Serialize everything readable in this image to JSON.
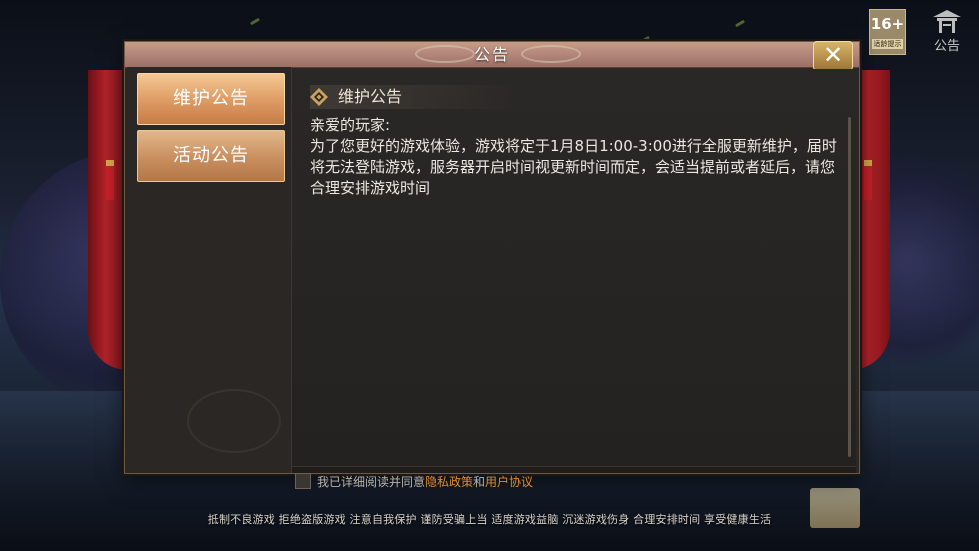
{
  "window": {
    "title": "公告",
    "close_label": "✕"
  },
  "top_right": {
    "age_rating": "16+",
    "age_tip": "适龄提示",
    "notice_label": "公告"
  },
  "sidebar": {
    "tabs": [
      {
        "label": "维护公告",
        "active": true
      },
      {
        "label": "活动公告",
        "active": false
      }
    ]
  },
  "content": {
    "heading": "维护公告",
    "greeting": "亲爱的玩家:",
    "body": "为了您更好的游戏体验，游戏将定于1月8日1:00-3:00进行全服更新维护，届时将无法登陆游戏，服务器开启时间视更新时间而定，会适当提前或者延后，请您合理安排游戏时间"
  },
  "agreement": {
    "prefix": "我已详细阅读并同意",
    "privacy_link": "隐私政策",
    "conjunction": "和",
    "user_link": "用户协议",
    "checked": false
  },
  "health_notice": "抵制不良游戏 拒绝盗版游戏 注意自我保护 谨防受骗上当 适度游戏益脑 沉迷游戏伤身 合理安排时间 享受健康生活",
  "colors": {
    "accent_link": "#e08a2a",
    "tab_active": "#dd9a62",
    "titlebar": "#b2867a"
  }
}
